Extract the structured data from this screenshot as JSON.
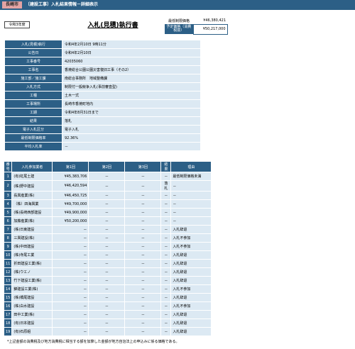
{
  "header": {
    "city": "長崎市",
    "page_title": "〔建設工事〕入札結果情報－詳細表示"
  },
  "era": "令和3年度",
  "doc_title": "入札(見積)執行書",
  "prices": {
    "min_limit_label": "最低制限価格",
    "min_limit_value": "¥46,380,421",
    "planned_label": "予定価格（消費税抜）",
    "planned_value": "¥50,217,000"
  },
  "info_rows": [
    {
      "label": "入札(見積)執行",
      "value": "令和4年2月10日 9時11分"
    },
    {
      "label": "公告日",
      "value": "令和4年2月10日"
    },
    {
      "label": "工事番号",
      "value": "42035060"
    },
    {
      "label": "工事名",
      "value": "香焼総合公園公園災害復旧工事（その2）"
    },
    {
      "label": "施工部／施工課",
      "value": "南総合事務所　地域整備課"
    },
    {
      "label": "入札方式",
      "value": "制限付一般競争入札(事前審査型)"
    },
    {
      "label": "工種",
      "value": "土木一式"
    },
    {
      "label": "工事場所",
      "value": "長崎市香焼町地内"
    },
    {
      "label": "工期",
      "value": "令和4年8月31日まで"
    },
    {
      "label": "結果",
      "value": "落札"
    },
    {
      "label": "電子入札区分",
      "value": "電子入札"
    },
    {
      "label": "最低制限価格率",
      "value": "92.36%"
    },
    {
      "label": "平均入札率",
      "value": "－"
    }
  ],
  "bid_headers": {
    "num": "番号",
    "name": "入札参加業者",
    "r1": "第1回",
    "r2": "第2回",
    "r3": "第3回",
    "result": "結果",
    "reason": "理由"
  },
  "bidders": [
    {
      "num": "1",
      "name": "(有)虹尾土建",
      "r1": "¥45,383,706",
      "r2": "－",
      "r3": "－",
      "result": "－",
      "reason": "最低制限価格未満"
    },
    {
      "num": "2",
      "name": "(株)野中建設",
      "r1": "¥46,420,594",
      "r2": "－",
      "r3": "－",
      "result": "落札",
      "reason": "－"
    },
    {
      "num": "3",
      "name": "長興産業(株)",
      "r1": "¥46,450,725",
      "r2": "－",
      "r3": "－",
      "result": "－",
      "reason": "－"
    },
    {
      "num": "4",
      "name": "（株）四海興業",
      "r1": "¥49,700,000",
      "r2": "－",
      "r3": "－",
      "result": "－",
      "reason": "－"
    },
    {
      "num": "5",
      "name": "(株)長崎西部建設",
      "r1": "¥49,900,000",
      "r2": "－",
      "r3": "－",
      "result": "－",
      "reason": "－"
    },
    {
      "num": "6",
      "name": "加藤産業(株)",
      "r1": "¥50,200,000",
      "r2": "－",
      "r3": "－",
      "result": "－",
      "reason": "－"
    },
    {
      "num": "7",
      "name": "(株)日東建設",
      "r1": "－",
      "r2": "－",
      "r3": "－",
      "result": "－",
      "reason": "入札辞退"
    },
    {
      "num": "8",
      "name": "三興建設(株)",
      "r1": "－",
      "r2": "－",
      "r3": "－",
      "result": "－",
      "reason": "入札不参加"
    },
    {
      "num": "9",
      "name": "(株)中田建設",
      "r1": "－",
      "r2": "－",
      "r3": "－",
      "result": "－",
      "reason": "入札不参加"
    },
    {
      "num": "10",
      "name": "(株)寺尾工業",
      "r1": "－",
      "r2": "－",
      "r3": "－",
      "result": "－",
      "reason": "入札辞退"
    },
    {
      "num": "11",
      "name": "折田建設工業(株)",
      "r1": "－",
      "r2": "－",
      "r3": "－",
      "result": "－",
      "reason": "入札辞退"
    },
    {
      "num": "12",
      "name": "(株)ウエノ",
      "r1": "－",
      "r2": "－",
      "r3": "－",
      "result": "－",
      "reason": "入札辞退"
    },
    {
      "num": "13",
      "name": "竹下建設工業(株)",
      "r1": "－",
      "r2": "－",
      "r3": "－",
      "result": "－",
      "reason": "入札辞退"
    },
    {
      "num": "14",
      "name": "錦建設工業(株)",
      "r1": "－",
      "r2": "－",
      "r3": "－",
      "result": "－",
      "reason": "入札不参加"
    },
    {
      "num": "15",
      "name": "(株)橋尾建設",
      "r1": "－",
      "r2": "－",
      "r3": "－",
      "result": "－",
      "reason": "入札辞退"
    },
    {
      "num": "16",
      "name": "(株)白水建設",
      "r1": "－",
      "r2": "－",
      "r3": "－",
      "result": "－",
      "reason": "入札不参加"
    },
    {
      "num": "17",
      "name": "田中工業(株)",
      "r1": "－",
      "r2": "－",
      "r3": "－",
      "result": "－",
      "reason": "入札辞退"
    },
    {
      "num": "18",
      "name": "(有)日本建設",
      "r1": "－",
      "r2": "－",
      "r3": "－",
      "result": "－",
      "reason": "入札辞退"
    },
    {
      "num": "19",
      "name": "(有)石原組",
      "r1": "－",
      "r2": "－",
      "r3": "－",
      "result": "－",
      "reason": "入札辞退"
    }
  ],
  "footnote": "*上記金額の消費税及び地方消費税に相当する額を加算した金額が地方自治法上の申込みに係る価格である。",
  "colors": {
    "header_blue": "#2c5f86",
    "cell_light_blue": "#dce9f3",
    "city_badge_pink": "#e3a3a3"
  }
}
